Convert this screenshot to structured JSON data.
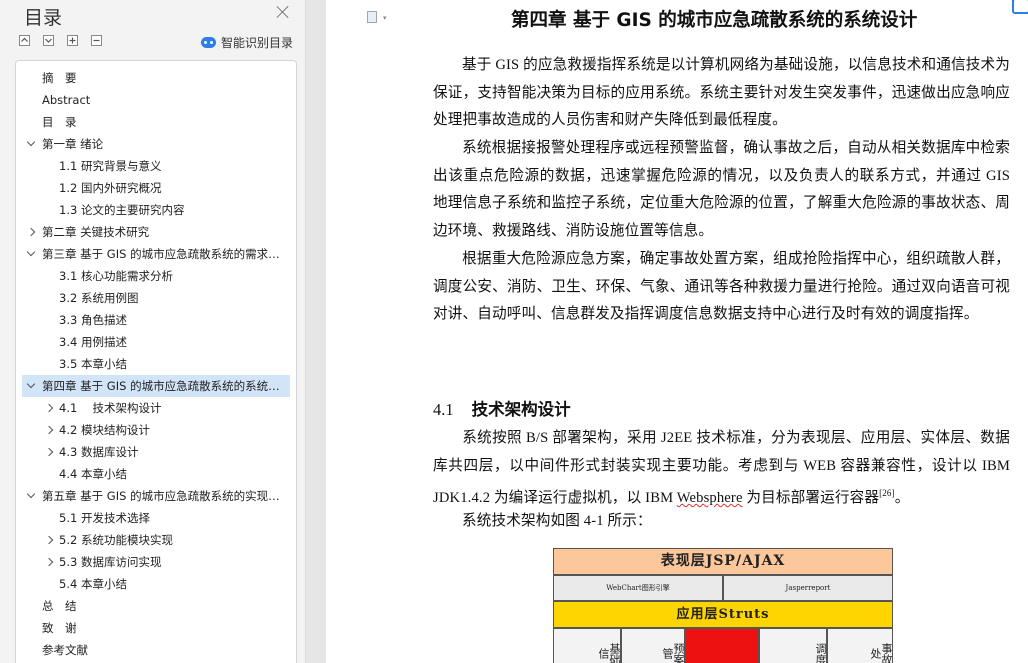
{
  "nav": {
    "title": "目录",
    "smart_toc_label": "智能识别目录",
    "items": [
      {
        "label": "摘　要",
        "level": 0,
        "expand": "none"
      },
      {
        "label": "Abstract",
        "level": 0,
        "expand": "none"
      },
      {
        "label": "目　录",
        "level": 0,
        "expand": "none"
      },
      {
        "label": "第一章  绪论",
        "level": 0,
        "expand": "expanded"
      },
      {
        "label": "1.1  研究背景与意义",
        "level": 1,
        "expand": "none"
      },
      {
        "label": "1.2  国内外研究概况",
        "level": 1,
        "expand": "none"
      },
      {
        "label": "1.3  论文的主要研究内容",
        "level": 1,
        "expand": "none"
      },
      {
        "label": "第二章  关键技术研究",
        "level": 0,
        "expand": "collapsed"
      },
      {
        "label": "第三章  基于 GIS 的城市应急疏散系统的需求分析",
        "level": 0,
        "expand": "expanded"
      },
      {
        "label": "3.1  核心功能需求分析",
        "level": 1,
        "expand": "none"
      },
      {
        "label": "3.2  系统用例图",
        "level": 1,
        "expand": "none"
      },
      {
        "label": "3.3  角色描述",
        "level": 1,
        "expand": "none"
      },
      {
        "label": "3.4  用例描述",
        "level": 1,
        "expand": "none"
      },
      {
        "label": "3.5  本章小结",
        "level": 1,
        "expand": "none"
      },
      {
        "label": "第四章  基于 GIS 的城市应急疏散系统的系统设计",
        "level": 0,
        "expand": "expanded",
        "selected": true
      },
      {
        "label": "4.1　 技术架构设计",
        "level": 1,
        "expand": "collapsed"
      },
      {
        "label": "4.2  模块结构设计",
        "level": 1,
        "expand": "collapsed"
      },
      {
        "label": "4.3  数据库设计",
        "level": 1,
        "expand": "collapsed"
      },
      {
        "label": "4.4  本章小结",
        "level": 1,
        "expand": "none"
      },
      {
        "label": "第五章  基于 GIS 的城市应急疏散系统的实现与测试",
        "level": 0,
        "expand": "expanded"
      },
      {
        "label": "5.1  开发技术选择",
        "level": 1,
        "expand": "none"
      },
      {
        "label": "5.2  系统功能模块实现",
        "level": 1,
        "expand": "collapsed"
      },
      {
        "label": "5.3  数据库访问实现",
        "level": 1,
        "expand": "collapsed"
      },
      {
        "label": "5.4  本章小结",
        "level": 1,
        "expand": "none"
      },
      {
        "label": "总　结",
        "level": 0,
        "expand": "none"
      },
      {
        "label": "致　谢",
        "level": 0,
        "expand": "none"
      },
      {
        "label": "参考文献",
        "level": 0,
        "expand": "none"
      }
    ]
  },
  "doc": {
    "chapter_title": "第四章  基于 GIS 的城市应急疏散系统的系统设计",
    "p1": "基于 GIS 的应急救援指挥系统是以计算机网络为基础设施，以信息技术和通信技术为保证，支持智能决策为目标的应用系统。系统主要针对发生突发事件，迅速做出应急响应处理把事故造成的人员伤害和财产失降低到最低程度。",
    "p2": "系统根据接报警处理程序或远程预警监督，确认事故之后，自动从相关数据库中检索出该重点危险源的数据，迅速掌握危险源的情况，以及负责人的联系方式，并通过 GIS 地理信息子系统和监控子系统，定位重大危险源的位置，了解重大危险源的事故状态、周边环境、救援路线、消防设施位置等信息。",
    "p3": "根据重大危险源应急方案，确定事故处置方案，组成抢险指挥中心，组织疏散人群，调度公安、消防、卫生、环保、气象、通讯等各种救援力量进行抢险。通过双向语音可视对讲、自动呼叫、信息群发及指挥调度信息数据支持中心进行及时有效的调度指挥。",
    "section_number": "4.1",
    "section_title": "技术架构设计",
    "p4_before": "系统按照 B/S 部署架构，采用 J2EE 技术标准，分为表现层、应用层、实体层、数据库共四层，以中间件形式封装实现主要功能。考虑到与 WEB 容器兼容性，设计以 IBM JDK1.4.2 为编译运行虚拟机，以 IBM ",
    "p4_wavy": "Websphere",
    "p4_after": " 为目标部署运行容器",
    "p4_cite": "[26]",
    "p4_end": "。",
    "p5": "系统技术架构如图 4-1 所示：",
    "diagram": {
      "presentation": "表现层JSP/AJAX",
      "webchart": "WebChart图形引擎",
      "jasper": "Jasperreport",
      "application": "应用层Struts",
      "modules": [
        "基础信",
        "预案管",
        "",
        "调度",
        "事故处"
      ]
    }
  }
}
